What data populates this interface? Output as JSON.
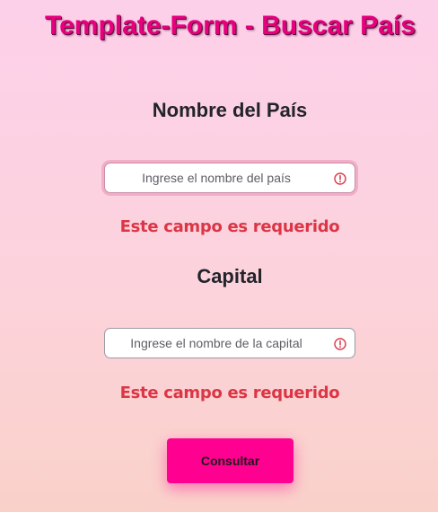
{
  "page": {
    "title": "Template-Form - Buscar País"
  },
  "form": {
    "country": {
      "label": "Nombre del País",
      "placeholder": "Ingrese el nombre del país",
      "error": "Este campo es requerido"
    },
    "capital": {
      "label": "Capital",
      "placeholder": "Ingrese el nombre de la capital",
      "error": "Este campo es requerido"
    },
    "submit_label": "Consultar"
  },
  "colors": {
    "title": "#e6007e",
    "error": "#dc3545",
    "button": "#ff0090"
  },
  "icons": {
    "field_status": "exclamation-circle-icon"
  }
}
